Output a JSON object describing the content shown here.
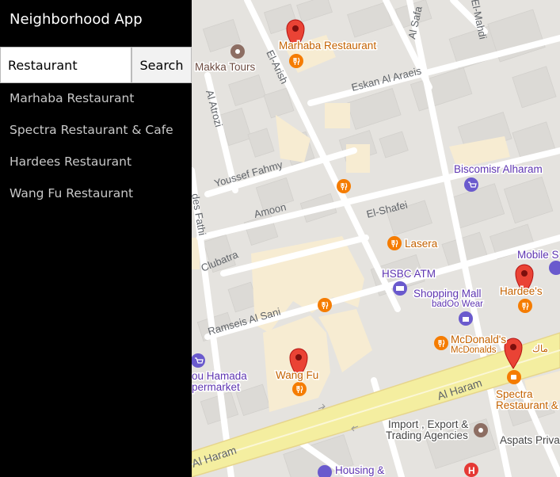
{
  "app": {
    "title": "Neighborhood App"
  },
  "search": {
    "value": "Restaurant",
    "button_label": "Search"
  },
  "results": [
    "Marhaba Restaurant",
    "Spectra Restaurant & Cafe",
    "Hardees Restaurant",
    "Wang Fu Restaurant"
  ],
  "map": {
    "street_labels": {
      "al_safa": "Al Safa",
      "el_mahdi": "El-Mahdi",
      "el_arish": "El-Arish",
      "eskan_al_araeis": "Eskan Al Araeis",
      "al_atrozi": "Al Atrozi",
      "youssef_fahmy": "Youssef Fahmy",
      "amoon": "Amoon",
      "el_shafei": "El-Shafei",
      "des_fathi": "des Fathi",
      "clubatra": "Clubatra",
      "ramseis_al_sani": "Ramseis Al Sani",
      "al_haram_1": "Al Haram",
      "al_haram_2": "Al Haram"
    },
    "place_labels": {
      "marhaba": "Marhaba Restaurant",
      "makka_tours": "Makka Tours",
      "biscomisr": "Biscomisr Alharam",
      "lasera": "Lasera",
      "hsbc_atm": "HSBC ATM",
      "mobile": "Mobile S",
      "shopping_mall": "Shopping Mall",
      "badoo_wear": "badOo Wear",
      "hardees": "Hardee's",
      "mcdonalds_1": "McDonald's",
      "mcdonalds_2": "McDonalds",
      "mcdonalds_ar": "ماك",
      "abou_hamada_1": "ou Hamada",
      "abou_hamada_2": "permarket",
      "wang_fu": "Wang Fu",
      "spectra_1": "Spectra",
      "spectra_2": "Restaurant &",
      "import_1": "Import , Export &",
      "import_2": "Trading Agencies",
      "aspats": "Aspats Priva",
      "housing_1": "Housing &"
    },
    "colors": {
      "land": "#e5e3df",
      "block": "#f4f3f0",
      "building": "#dcdad6",
      "road": "#ffffff",
      "highway": "#f4eea0",
      "campus": "#f7ecd2",
      "restaurant_icon": "#f57c00",
      "shop_icon": "#6a5acd",
      "marker": "#ea4335",
      "brown_icon": "#8d6e63",
      "place_text_orange": "#c46200",
      "place_text_purple": "#5e35b1",
      "street_text": "#5f6368"
    },
    "icons": [
      "restaurant-icon",
      "shopping-bag-icon",
      "shopping-cart-icon",
      "atm-icon",
      "camera-icon",
      "hospital-icon",
      "map-marker-icon"
    ]
  }
}
